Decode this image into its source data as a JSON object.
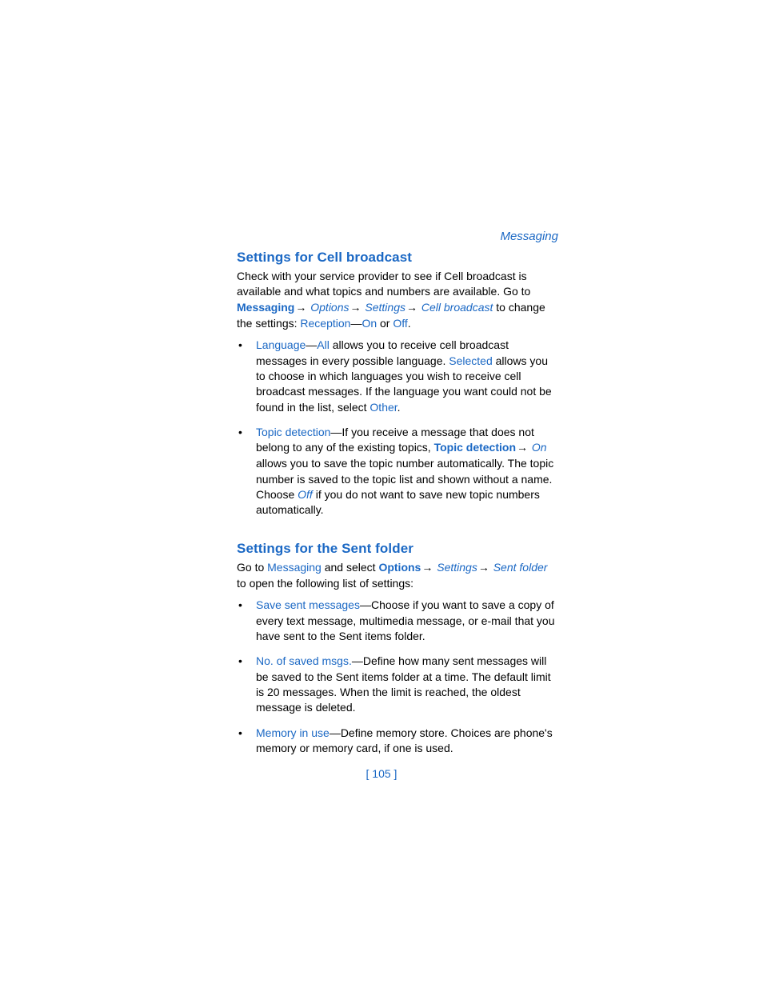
{
  "header": {
    "section": "Messaging"
  },
  "section1": {
    "title": "Settings for Cell broadcast",
    "intro_1": "Check with your service provider to see if Cell broadcast is available and what topics and numbers are available. Go to ",
    "intro_messaging": "Messaging",
    "intro_options": "Options",
    "intro_settings": "Settings",
    "intro_cell": "Cell broadcast",
    "intro_2": " to change the settings: ",
    "intro_reception": "Reception",
    "intro_dash": "—",
    "intro_on": "On",
    "intro_or": " or ",
    "intro_off": "Off",
    "intro_end": ".",
    "bullets": [
      {
        "lead": "Language",
        "t1": "—",
        "v1": "All",
        "t2": " allows you to receive cell broadcast messages in every possible language. ",
        "v2": "Selected",
        "t3": " allows you to choose in which languages you wish to receive cell broadcast messages. If the language you want could not be found in the list, select ",
        "v3": "Other",
        "t4": "."
      },
      {
        "lead": "Topic detection",
        "t1": "—If you receive a message that does not belong to any of the existing topics, ",
        "bold1": "Topic detection",
        "it1": "On",
        "t2": " allows you to save the topic number automatically. The topic number is saved to the topic list and shown without a name. Choose ",
        "it2": "Off",
        "t3": " if you do not want to save new topic numbers automatically."
      }
    ]
  },
  "section2": {
    "title": "Settings for the Sent folder",
    "intro_1": "Go to ",
    "intro_messaging": "Messaging",
    "intro_2": " and select ",
    "intro_options": "Options",
    "intro_settings": "Settings",
    "intro_sent": "Sent folder",
    "intro_3": " to open the following list of settings:",
    "bullets": [
      {
        "lead": "Save sent messages",
        "text": "—Choose if you want to save a copy of every text message, multimedia message, or e-mail that you have sent to the Sent items folder."
      },
      {
        "lead": "No. of saved msgs.",
        "text": "—Define how many sent messages will be saved to the Sent items folder at a time. The default limit is 20 messages. When the limit is reached, the oldest message is deleted."
      },
      {
        "lead": "Memory in use",
        "text": "—Define memory store. Choices are phone's memory or memory card, if one is used."
      }
    ]
  },
  "page_number": "[ 105 ]",
  "arrow": "→"
}
